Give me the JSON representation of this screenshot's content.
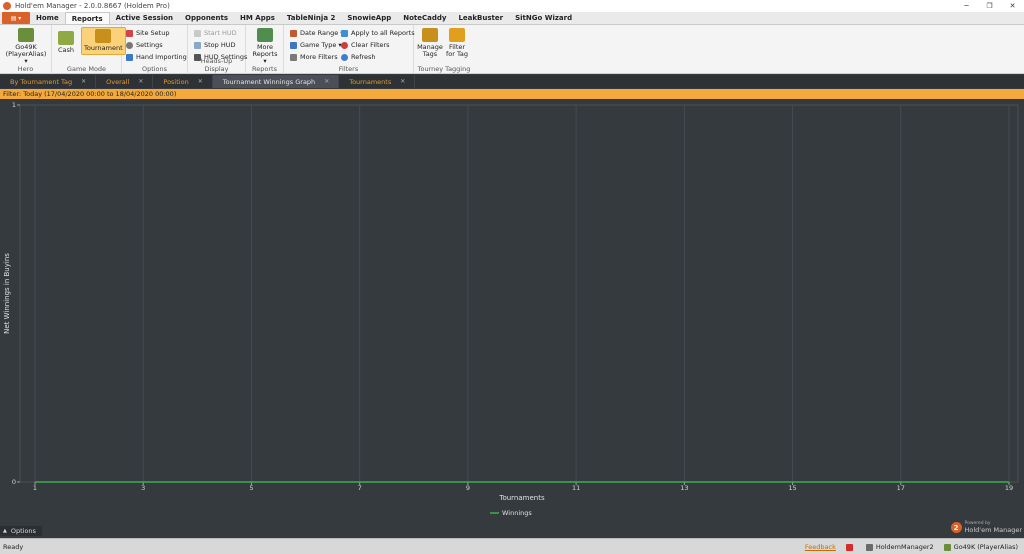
{
  "window": {
    "title": "Hold'em Manager - 2.0.0.8667 (Holdem Pro)"
  },
  "menu": {
    "tabs": [
      {
        "label": "Home"
      },
      {
        "label": "Reports",
        "active": true
      },
      {
        "label": "Active Session"
      },
      {
        "label": "Opponents"
      },
      {
        "label": "HM Apps"
      },
      {
        "label": "TableNinja 2"
      },
      {
        "label": "SnowieApp"
      },
      {
        "label": "NoteCaddy"
      },
      {
        "label": "LeakBuster"
      },
      {
        "label": "SitNGo Wizard"
      }
    ]
  },
  "ribbon": {
    "hero": {
      "name": "Go49K",
      "alias": "(PlayerAlias) ▾",
      "group_label": "Hero"
    },
    "game_mode": {
      "cash": "Cash",
      "tournament": "Tournament",
      "group_label": "Game Mode"
    },
    "options": {
      "site_setup": "Site Setup",
      "settings": "Settings",
      "hand_importing": "Hand Importing",
      "group_label": "Options"
    },
    "hud": {
      "start": "Start HUD",
      "stop": "Stop HUD",
      "settings": "HUD Settings",
      "group_label": "Heads-Up Display"
    },
    "reports": {
      "more_reports_1": "More",
      "more_reports_2": "Reports ▾",
      "group_label": "Reports"
    },
    "filters": {
      "date_range": "Date Range ▾",
      "game_type": "Game Type ▾",
      "more_filters": "More Filters",
      "apply_all": "Apply to all Reports",
      "clear": "Clear Filters",
      "refresh": "Refresh",
      "group_label": "Filters"
    },
    "tagging": {
      "manage_1": "Manage",
      "manage_2": "Tags",
      "filter_1": "Filter",
      "filter_2": "for Tag",
      "group_label": "Tourney Tagging"
    }
  },
  "doc_tabs": [
    {
      "label": "By Tournament Tag"
    },
    {
      "label": "Overall"
    },
    {
      "label": "Position"
    },
    {
      "label": "Tournament Winnings Graph",
      "active": true
    },
    {
      "label": "Tournaments"
    }
  ],
  "filter_text": "Filter: Today (17/04/2020 00:00 to 18/04/2020 00:00)",
  "chart_data": {
    "type": "line",
    "xlabel": "Tournaments",
    "ylabel": "Net Winnings in Buyins",
    "x_ticks": [
      1,
      3,
      5,
      7,
      9,
      11,
      13,
      15,
      17,
      19
    ],
    "xlim": [
      1,
      19
    ],
    "ylim": [
      0,
      1
    ],
    "y_ticks": [
      0,
      1
    ],
    "grid": true,
    "legend_position": "bottom-center",
    "series": [
      {
        "name": "Winnings",
        "color": "#3fae49",
        "x": [
          1,
          19
        ],
        "values": [
          0,
          0
        ]
      }
    ]
  },
  "options_label": "Options",
  "powered": {
    "line1": "Powered by",
    "line2": "Hold'em Manager"
  },
  "status": {
    "ready": "Ready",
    "feedback": "Feedback",
    "db": "HoldemManager2",
    "player": "Go49K (PlayerAlias)"
  }
}
